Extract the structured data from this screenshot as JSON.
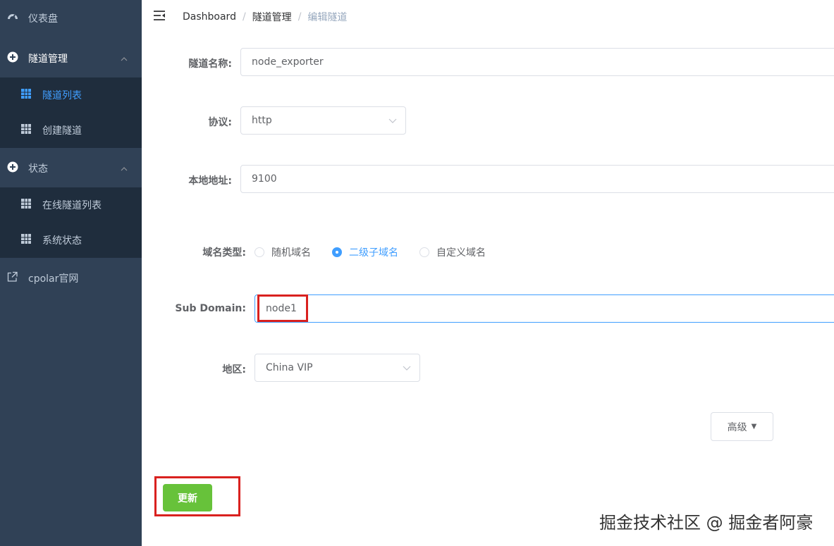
{
  "sidebar": {
    "dashboard": {
      "label": "仪表盘",
      "icon": "speedometer-icon"
    },
    "tunnel_mgmt": {
      "label": "隧道管理",
      "icon": "circle-plus-icon"
    },
    "tunnel_items": [
      {
        "label": "隧道列表",
        "icon": "table-icon",
        "active": true
      },
      {
        "label": "创建隧道",
        "icon": "table-icon",
        "active": false
      }
    ],
    "status": {
      "label": "状态",
      "icon": "circle-plus-icon"
    },
    "status_items": [
      {
        "label": "在线隧道列表",
        "icon": "table-icon"
      },
      {
        "label": "系统状态",
        "icon": "table-icon"
      }
    ],
    "cpolar": {
      "label": "cpolar官网",
      "icon": "external-link-icon"
    }
  },
  "breadcrumb": [
    "Dashboard",
    "隧道管理",
    "编辑隧道"
  ],
  "form": {
    "name": {
      "label": "隧道名称:",
      "value": "node_exporter"
    },
    "protocol": {
      "label": "协议:",
      "value": "http"
    },
    "local_addr": {
      "label": "本地地址:",
      "value": "9100"
    },
    "domain_type": {
      "label": "域名类型:",
      "options": [
        "随机域名",
        "二级子域名",
        "自定义域名"
      ],
      "selected": "二级子域名"
    },
    "sub_domain": {
      "label": "Sub Domain:",
      "value": "node1"
    },
    "region": {
      "label": "地区:",
      "value": "China VIP"
    },
    "advanced_label": "高级",
    "update_label": "更新"
  },
  "watermark": "掘金技术社区 @ 掘金者阿豪",
  "colors": {
    "sidebar_bg": "#304156",
    "submenu_bg": "#1f2d3d",
    "active": "#409eff",
    "update_btn": "#67c23a",
    "highlight": "#d9211f"
  }
}
